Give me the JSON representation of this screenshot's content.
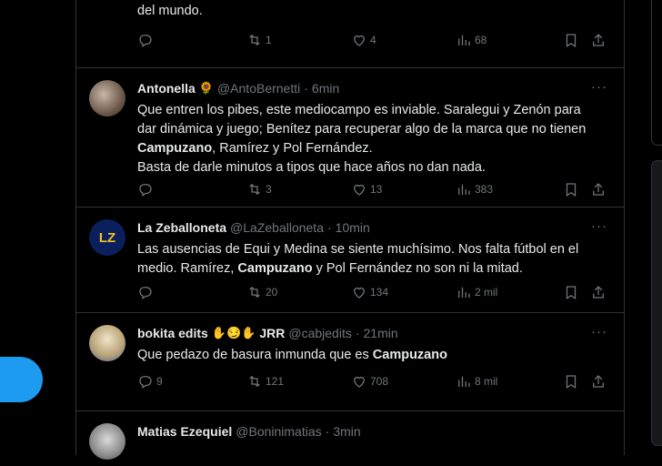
{
  "posts": [
    {
      "text_parts": [
        {
          "t": "del mundo."
        }
      ],
      "replies": "",
      "reposts": "1",
      "likes": "4",
      "views": "68"
    },
    {
      "name": "Antonella",
      "name_emoji": "🌻",
      "handle": "@AntoBernetti",
      "sep": "·",
      "time": "6min",
      "more": "···",
      "lines": [
        [
          {
            "t": "Que entren los pibes, este mediocampo es inviable. Saralegui y Zenón para"
          }
        ],
        [
          {
            "t": "dar dinámica y juego; Benítez para recuperar algo de la marca que no tienen"
          }
        ],
        [
          {
            "t": "Campuzano",
            "b": true
          },
          {
            "t": ", Ramírez y Pol Fernández."
          }
        ],
        [
          {
            "t": "Basta de darle minutos a tipos que hace años no dan nada."
          }
        ]
      ],
      "replies": "",
      "reposts": "3",
      "likes": "13",
      "views": "383"
    },
    {
      "name": "La Zeballoneta",
      "avatar_text": "LZ",
      "handle": "@LaZeballoneta",
      "sep": "·",
      "time": "10min",
      "more": "···",
      "lines": [
        [
          {
            "t": "Las ausencias de Equi y Medina se siente muchísimo. Nos falta fútbol en el"
          }
        ],
        [
          {
            "t": "medio. Ramírez, "
          },
          {
            "t": "Campuzano",
            "b": true
          },
          {
            "t": " y Pol Fernández no son ni la mitad."
          }
        ]
      ],
      "replies": "",
      "reposts": "20",
      "likes": "134",
      "views": "2 mil"
    },
    {
      "name": "bokita edits",
      "name_emoji": "✋😏✋",
      "name_suffix": "JRR",
      "handle": "@cabjedits",
      "sep": "·",
      "time": "21min",
      "more": "···",
      "lines": [
        [
          {
            "t": "Que pedazo de basura inmunda que es "
          },
          {
            "t": "Campuzano",
            "b": true
          }
        ]
      ],
      "replies": "9",
      "reposts": "121",
      "likes": "708",
      "views": "8 mil"
    },
    {
      "name": "Matias Ezequiel",
      "handle": "@Boninimatias",
      "sep": "·",
      "time": "3min"
    }
  ],
  "icons": {
    "reply": "reply-icon",
    "repost": "repost-icon",
    "like": "heart-icon",
    "views": "views-chart-icon",
    "bookmark": "bookmark-icon",
    "share": "share-icon",
    "more": "more-icon"
  },
  "colors": {
    "accent": "#1d9bf0",
    "muted": "#71767b",
    "border": "#2f3336"
  }
}
